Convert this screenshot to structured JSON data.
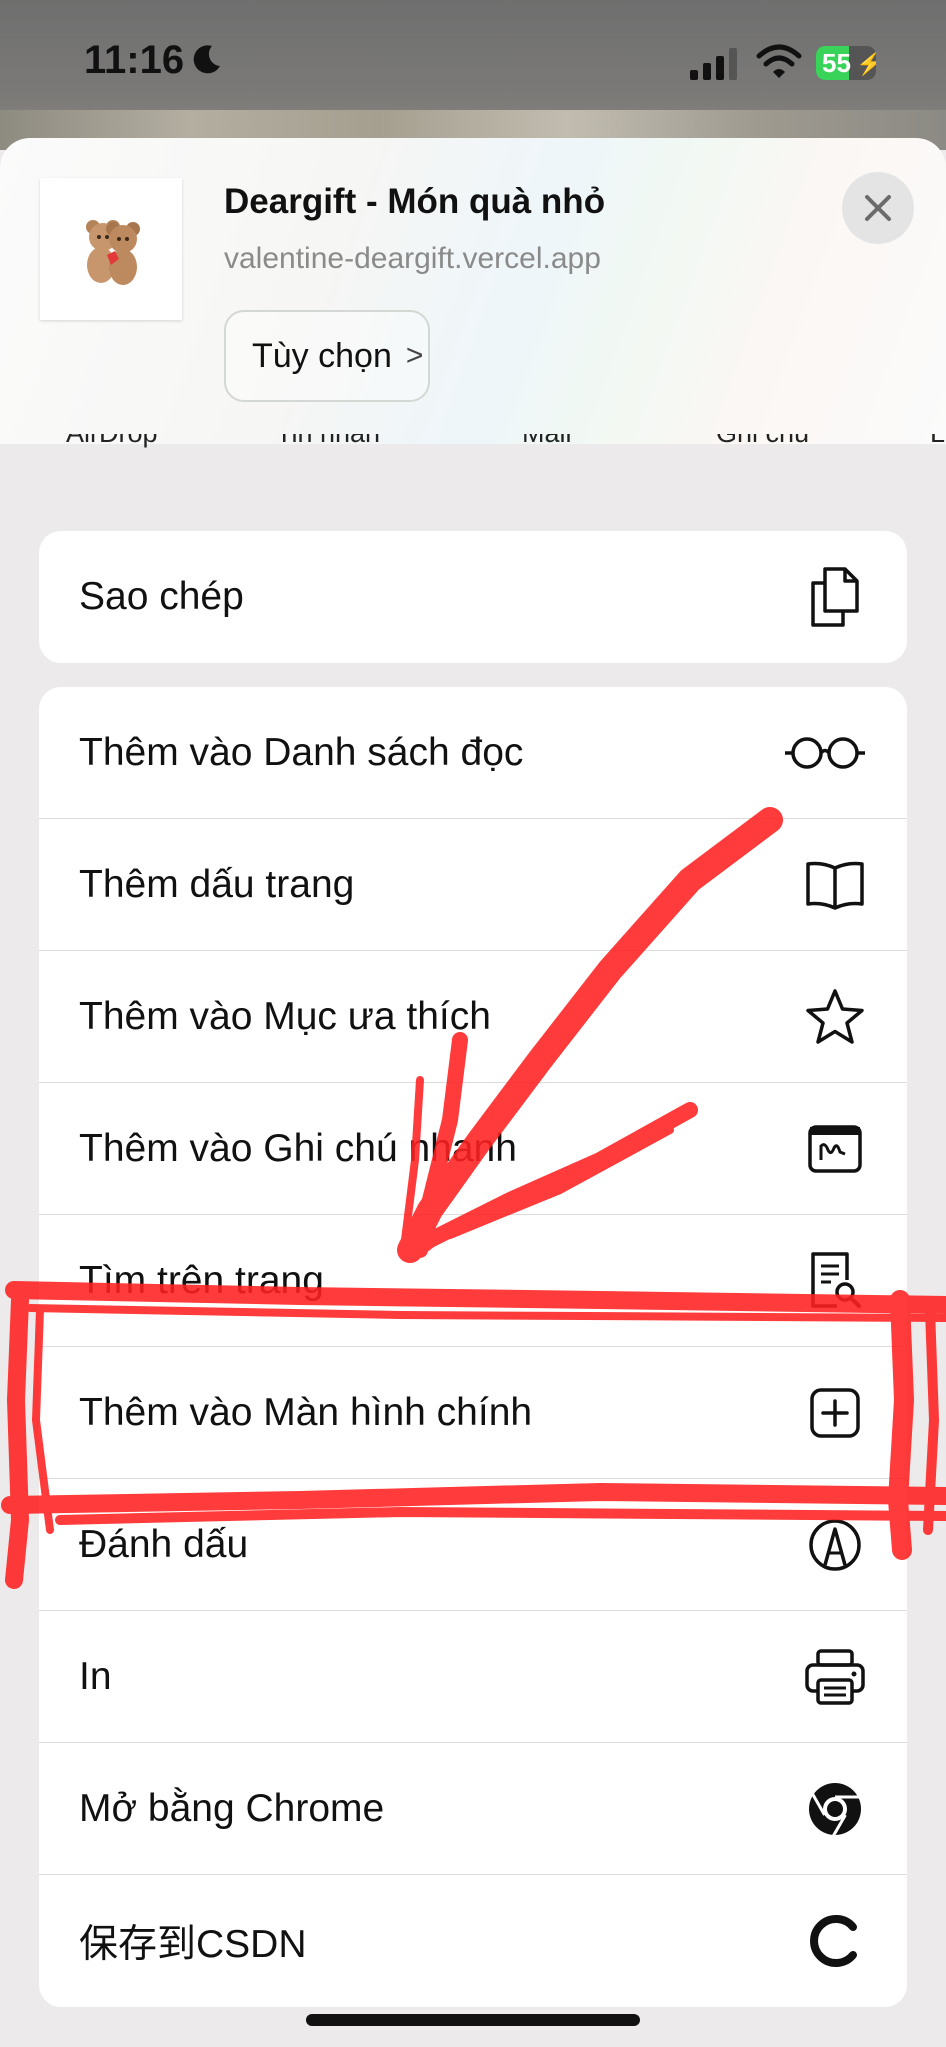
{
  "status_bar": {
    "time": "11:16",
    "battery": "55",
    "battery_level": 0.55,
    "icons": [
      "moon-icon",
      "cellular-signal-icon",
      "wifi-icon",
      "battery-charging-icon"
    ]
  },
  "share_header": {
    "title": "Deargift - Món quà nhỏ",
    "url": "valentine-deargift.vercel.app",
    "options_label": "Tùy chọn"
  },
  "apps": [
    "AirDrop",
    "Tin nhắn",
    "Mail",
    "Ghi chú",
    "L"
  ],
  "group1": [
    {
      "label": "Sao chép",
      "icon": "copy-icon"
    }
  ],
  "group2": [
    {
      "label": "Thêm vào Danh sách đọc",
      "icon": "glasses-icon"
    },
    {
      "label": "Thêm dấu trang",
      "icon": "book-icon"
    },
    {
      "label": "Thêm vào Mục ưa thích",
      "icon": "star-icon"
    },
    {
      "label": "Thêm vào Ghi chú nhanh",
      "icon": "quick-note-icon"
    },
    {
      "label": "Tìm trên trang",
      "icon": "find-on-page-icon"
    },
    {
      "label": "Thêm vào Màn hình chính",
      "icon": "add-square-icon"
    },
    {
      "label": "Đánh dấu",
      "icon": "markup-icon"
    },
    {
      "label": "In",
      "icon": "printer-icon"
    },
    {
      "label": "Mở bằng Chrome",
      "icon": "chrome-icon"
    },
    {
      "label": "保存到CSDN",
      "icon": "csdn-icon"
    }
  ],
  "colors": {
    "annotation": "#ff2020",
    "sheet_background": "#eceaea",
    "battery_green": "#3ad35a"
  }
}
